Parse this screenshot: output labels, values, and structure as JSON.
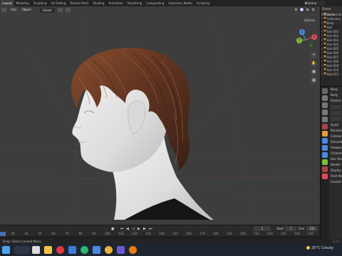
{
  "topbar": {
    "tabs": [
      "Layout",
      "Modeling",
      "Sculpting",
      "UV Editing",
      "Texture Paint",
      "Shading",
      "Animation",
      "Rendering",
      "Compositing",
      "Geometry Nodes",
      "Scripting"
    ],
    "active_tab": "Layout",
    "scene": "Scene"
  },
  "viewport": {
    "header": {
      "add": "Add",
      "object": "Object",
      "orientation": "Global"
    },
    "options": "Options",
    "gizmo": {
      "x": "X",
      "y": "Y",
      "z": "Z"
    },
    "colors": {
      "x": "#e04a5a",
      "y": "#7bbf3a",
      "z": "#4a8ae0",
      "background": "#3d3d3d",
      "skin": "#e8e8e8",
      "hair": "#6b3a22"
    }
  },
  "timeline": {
    "ruler_ticks": [
      "30",
      "40",
      "50",
      "60",
      "70",
      "80",
      "90",
      "100",
      "110",
      "120",
      "130",
      "140",
      "150",
      "160",
      "170",
      "180",
      "190",
      "200",
      "210",
      "220",
      "230",
      "240",
      "250"
    ],
    "current_frame": "1",
    "start_label": "Start",
    "start_value": "1",
    "end_label": "End",
    "end_value": "250"
  },
  "outliner": {
    "header": "Scene Collection",
    "rows": [
      "Scene Collection",
      "Collection",
      "Body",
      "Hair",
      "Hair.001",
      "Hair.002",
      "Hair.003",
      "Hair.004",
      "Hair.005",
      "Hair.006",
      "Hair.007",
      "Hair.008",
      "Hair.009",
      "Hair.010",
      "Hair.011"
    ]
  },
  "properties": {
    "rows": [
      "Body",
      "Body",
      "Particle",
      "",
      "",
      "",
      "Quick",
      "Rendering",
      "Collision",
      "Simulation",
      "Viewport",
      "Children",
      "Hair Shape",
      "Render",
      "Display",
      "Field Weights",
      "Custom Props"
    ]
  },
  "statusbar": {
    "text": "Drag: Select Context Menu",
    "version": "3.2.1"
  },
  "taskbar": {
    "weather": "20°C  Cloudy"
  }
}
